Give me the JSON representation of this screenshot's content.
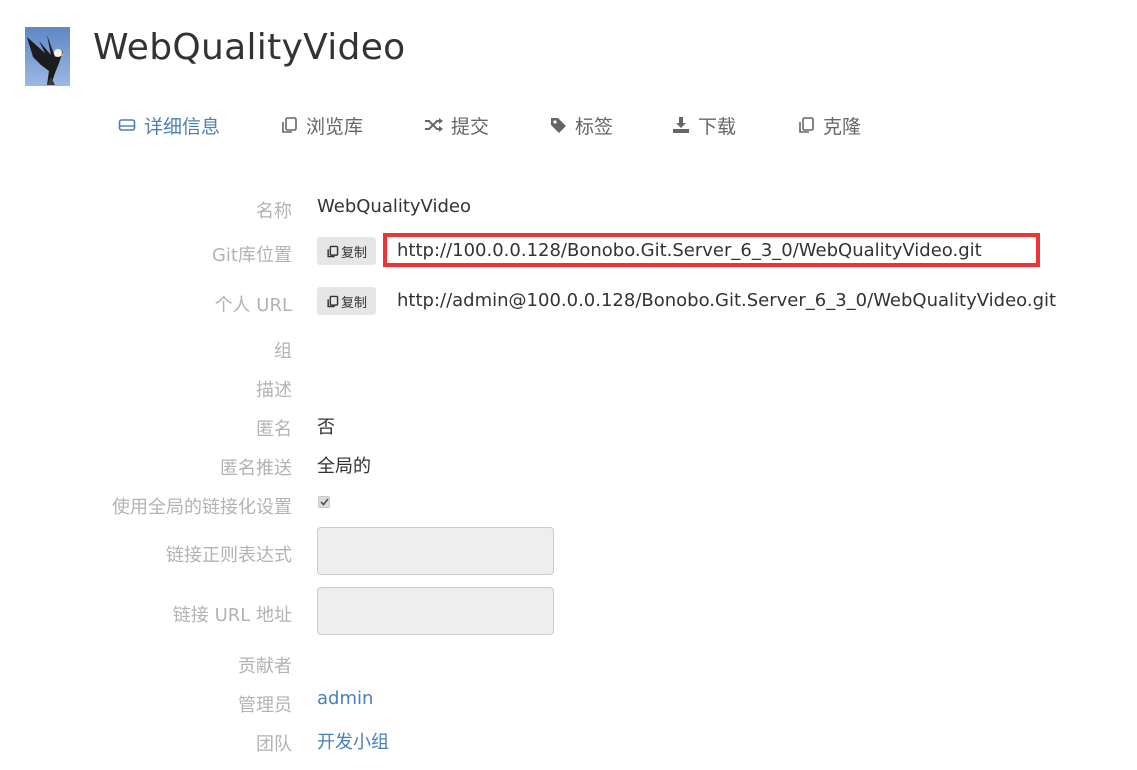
{
  "header": {
    "title": "WebQualityVideo",
    "logo_icon": "eagle-logo-icon"
  },
  "nav": {
    "tabs": [
      {
        "label": "详细信息",
        "icon": "drive-icon",
        "active": true
      },
      {
        "label": "浏览库",
        "icon": "copy-icon",
        "active": false
      },
      {
        "label": "提交",
        "icon": "shuffle-icon",
        "active": false
      },
      {
        "label": "标签",
        "icon": "tag-icon",
        "active": false
      },
      {
        "label": "下载",
        "icon": "download-icon",
        "active": false
      },
      {
        "label": "克隆",
        "icon": "copy-icon",
        "active": false
      }
    ]
  },
  "details": {
    "name": {
      "label": "名称",
      "value": "WebQualityVideo"
    },
    "git_location": {
      "label": "Git库位置",
      "copy_label": "复制",
      "value": "http://100.0.0.128/Bonobo.Git.Server_6_3_0/WebQualityVideo.git"
    },
    "personal_url": {
      "label": "个人 URL",
      "copy_label": "复制",
      "value": "http://admin@100.0.0.128/Bonobo.Git.Server_6_3_0/WebQualityVideo.git"
    },
    "group": {
      "label": "组",
      "value": ""
    },
    "description": {
      "label": "描述",
      "value": ""
    },
    "anonymous": {
      "label": "匿名",
      "value": "否"
    },
    "anonymous_push": {
      "label": "匿名推送",
      "value": "全局的"
    },
    "use_global_linkify": {
      "label": "使用全局的链接化设置",
      "checked": true
    },
    "linkify_regex": {
      "label": "链接正则表达式",
      "value": ""
    },
    "linkify_url": {
      "label": "链接 URL 地址",
      "value": ""
    },
    "contributors": {
      "label": "贡献者",
      "value": ""
    },
    "admins": {
      "label": "管理员",
      "value": "admin"
    },
    "teams": {
      "label": "团队",
      "value": "开发小组"
    }
  },
  "colors": {
    "accent": "#4a7fb8",
    "label": "#b3b3b3",
    "highlight": "#ee3236"
  }
}
